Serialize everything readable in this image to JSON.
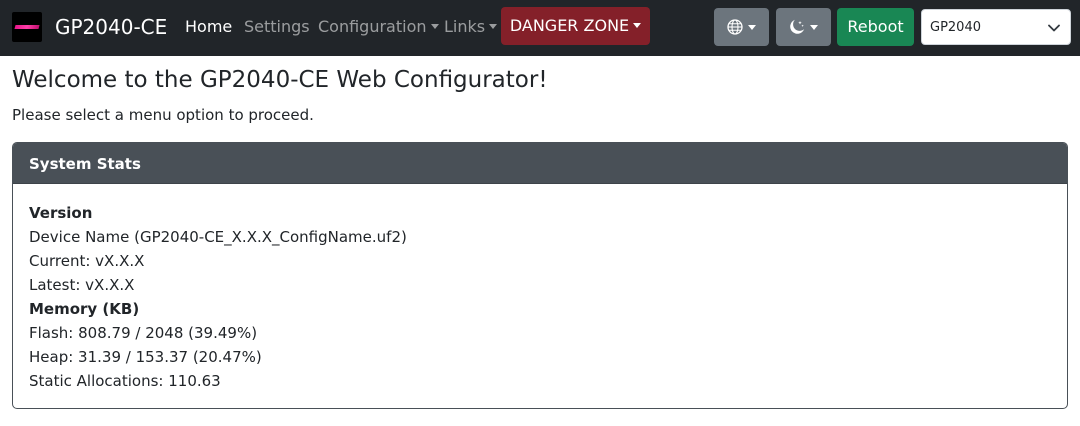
{
  "navbar": {
    "brand": "GP2040-CE",
    "logo_icon": "gp2040-logo-icon",
    "links": {
      "home": "Home",
      "settings": "Settings",
      "configuration": "Configuration",
      "links": "Links"
    },
    "danger_zone": "DANGER ZONE",
    "language_icon": "globe-icon",
    "theme_icon": "moon-stars-icon",
    "reboot": "Reboot",
    "board_select": {
      "selected": "GP2040"
    }
  },
  "colors": {
    "navbar_bg": "#212529",
    "danger": "#842029",
    "secondary": "#6c757d",
    "success": "#198754",
    "card_header": "#495057"
  },
  "main": {
    "title": "Welcome to the GP2040-CE Web Configurator!",
    "intro": "Please select a menu option to proceed."
  },
  "system_stats": {
    "header": "System Stats",
    "version_heading": "Version",
    "device_name": "Device Name (GP2040-CE_X.X.X_ConfigName.uf2)",
    "current": "Current: vX.X.X",
    "latest": "Latest: vX.X.X",
    "memory_heading": "Memory (KB)",
    "flash": "Flash: 808.79 / 2048 (39.49%)",
    "heap": "Heap: 31.39 / 153.37 (20.47%)",
    "static_allocations": "Static Allocations: 110.63"
  }
}
